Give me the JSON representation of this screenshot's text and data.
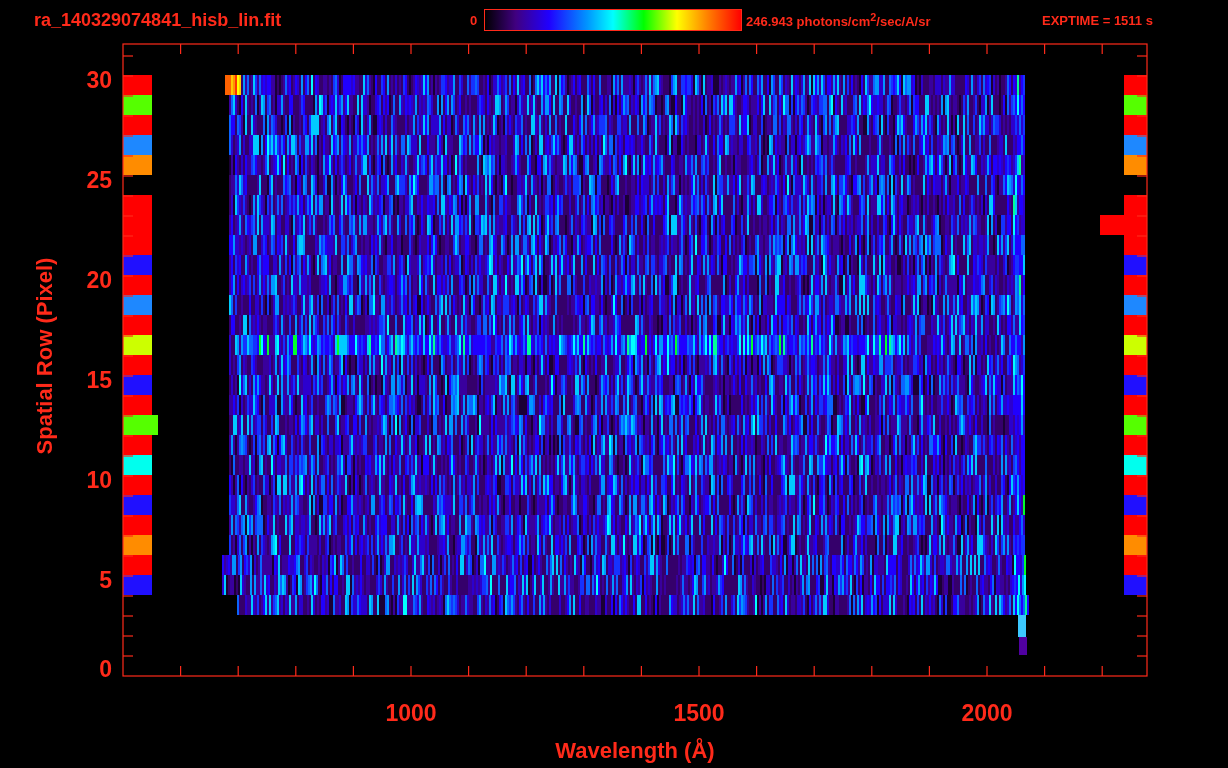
{
  "header": {
    "filename": "ra_140329074841_hisb_lin.fit",
    "colorbar_min": "0",
    "colorbar_max": "246.943 photons/cm$^{2}$/sec/A/sr",
    "exposure": "EXPTIME = 1511 s"
  },
  "plot": {
    "xlabel": "Wavelength (Å)",
    "ylabel": "Spatial Row (Pixel)",
    "xticks": [
      "1000",
      "1500",
      "2000"
    ],
    "yticks": [
      "30",
      "25",
      "20",
      "15",
      "10",
      "5",
      "0"
    ]
  },
  "left_flags": [
    {
      "kind": "flag",
      "color": "#ff0000",
      "extended": false
    },
    {
      "kind": "flag",
      "color": "#55ff00",
      "extended": false
    },
    {
      "kind": "flag",
      "color": "#ff0000",
      "extended": false
    },
    {
      "kind": "flag",
      "color": "#1e88ff",
      "extended": false
    },
    {
      "kind": "flag",
      "color": "#ff8c00",
      "extended": false
    },
    {
      "kind": "gap"
    },
    {
      "kind": "flag",
      "color": "#ff0000",
      "extended": false
    },
    {
      "kind": "flag",
      "color": "#ff0000",
      "extended": false
    },
    {
      "kind": "flag",
      "color": "#ff0000",
      "extended": false
    },
    {
      "kind": "flag",
      "color": "#2010ff",
      "extended": false
    },
    {
      "kind": "flag",
      "color": "#ff0000",
      "extended": false
    },
    {
      "kind": "flag",
      "color": "#1e88ff",
      "extended": false
    },
    {
      "kind": "flag",
      "color": "#ff0000",
      "extended": false
    },
    {
      "kind": "flag",
      "color": "#ccff00",
      "extended": false
    },
    {
      "kind": "flag",
      "color": "#ff0000",
      "extended": false
    },
    {
      "kind": "flag",
      "color": "#2010ff",
      "extended": false
    },
    {
      "kind": "flag",
      "color": "#ff0000",
      "extended": false
    },
    {
      "kind": "flag",
      "color": "#55ff00",
      "extended": true
    },
    {
      "kind": "flag",
      "color": "#ff0000",
      "extended": false
    },
    {
      "kind": "flag",
      "color": "#00ffee",
      "extended": false
    },
    {
      "kind": "flag",
      "color": "#ff0000",
      "extended": false
    },
    {
      "kind": "flag",
      "color": "#2010ff",
      "extended": false
    },
    {
      "kind": "flag",
      "color": "#ff0000",
      "extended": false
    },
    {
      "kind": "flag",
      "color": "#ff8c00",
      "extended": false
    },
    {
      "kind": "flag",
      "color": "#ff0000",
      "extended": false
    },
    {
      "kind": "flag",
      "color": "#2010ff",
      "extended": false
    }
  ],
  "right_flags": [
    {
      "kind": "flag",
      "color": "#ff0000",
      "extended": false
    },
    {
      "kind": "flag",
      "color": "#55ff00",
      "extended": false
    },
    {
      "kind": "flag",
      "color": "#ff0000",
      "extended": false
    },
    {
      "kind": "flag",
      "color": "#1e88ff",
      "extended": false
    },
    {
      "kind": "flag",
      "color": "#ff8c00",
      "extended": false
    },
    {
      "kind": "gap"
    },
    {
      "kind": "flag",
      "color": "#ff0000",
      "extended": false
    },
    {
      "kind": "flag",
      "color": "#ff0000",
      "extended": true
    },
    {
      "kind": "flag",
      "color": "#ff0000",
      "extended": false
    },
    {
      "kind": "flag",
      "color": "#2010ff",
      "extended": false
    },
    {
      "kind": "flag",
      "color": "#ff0000",
      "extended": false
    },
    {
      "kind": "flag",
      "color": "#1e88ff",
      "extended": false
    },
    {
      "kind": "flag",
      "color": "#ff0000",
      "extended": false
    },
    {
      "kind": "flag",
      "color": "#ccff00",
      "extended": false
    },
    {
      "kind": "flag",
      "color": "#ff0000",
      "extended": false
    },
    {
      "kind": "flag",
      "color": "#2010ff",
      "extended": false
    },
    {
      "kind": "flag",
      "color": "#ff0000",
      "extended": false
    },
    {
      "kind": "flag",
      "color": "#55ff00",
      "extended": false
    },
    {
      "kind": "flag",
      "color": "#ff0000",
      "extended": false
    },
    {
      "kind": "flag",
      "color": "#00ffee",
      "extended": false
    },
    {
      "kind": "flag",
      "color": "#ff0000",
      "extended": false
    },
    {
      "kind": "flag",
      "color": "#2010ff",
      "extended": false
    },
    {
      "kind": "flag",
      "color": "#ff0000",
      "extended": false
    },
    {
      "kind": "flag",
      "color": "#ff8c00",
      "extended": false
    },
    {
      "kind": "flag",
      "color": "#ff0000",
      "extended": false
    },
    {
      "kind": "flag",
      "color": "#2010ff",
      "extended": false
    }
  ]
}
